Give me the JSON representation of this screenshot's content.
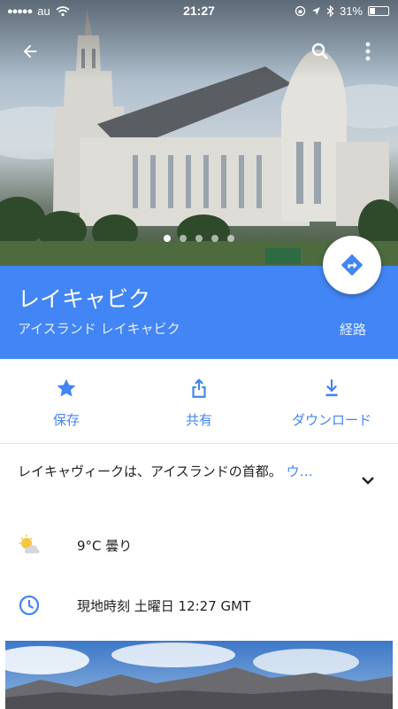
{
  "status_bar": {
    "carrier": "au",
    "time": "21:27",
    "battery": "31%",
    "battery_level": 0.31
  },
  "hero": {
    "photo_subject": "hallgrimskirkja-church-photo",
    "pages": 5,
    "active_page": 0
  },
  "place": {
    "name": "レイキャビク",
    "subtitle": "アイスランド レイキャビク",
    "route_label": "経路"
  },
  "actions": [
    {
      "label": "保存",
      "icon": "star-icon"
    },
    {
      "label": "共有",
      "icon": "share-icon"
    },
    {
      "label": "ダウンロード",
      "icon": "download-icon"
    }
  ],
  "description": {
    "text": "レイキャヴィークは、アイスランドの首都。",
    "more": "ウ…"
  },
  "weather": {
    "text": "9°C 曇り",
    "icon": "partly-cloudy-icon"
  },
  "local_time": {
    "text": "現地時刻 土曜日 12:27 GMT",
    "icon": "clock-icon"
  },
  "colors": {
    "accent": "#4285f4",
    "text": "#212121"
  }
}
